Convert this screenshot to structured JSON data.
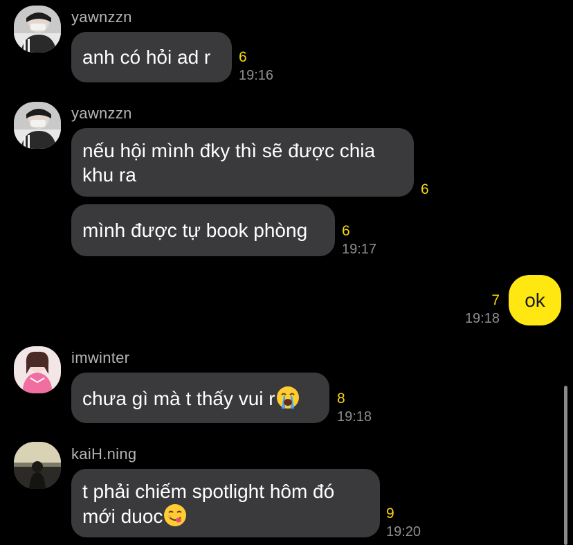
{
  "colors": {
    "background": "#000000",
    "incoming_bubble": "#3a3a3c",
    "outgoing_bubble": "#ffe812",
    "unread_count": "#f5d90a",
    "timestamp": "#8e8e93"
  },
  "messages": [
    {
      "sender": "yawnzzn",
      "avatar": "avatar-yawnzzn",
      "lines": [
        "anh có hỏi ad r"
      ],
      "unread": "6",
      "time": "19:16"
    },
    {
      "sender": "yawnzzn",
      "avatar": "avatar-yawnzzn",
      "lines": [
        "nếu hội mình đky thì sẽ được chia",
        "khu ra"
      ],
      "unread": "6",
      "time": ""
    },
    {
      "lines": [
        "mình được tự book phòng"
      ],
      "unread": "6",
      "time": "19:17"
    },
    {
      "outgoing": true,
      "lines": [
        "ok"
      ],
      "unread": "7",
      "time": "19:18"
    },
    {
      "sender": "imwinter",
      "avatar": "avatar-imwinter",
      "lines": [
        "chưa gì mà t thấy vui r"
      ],
      "emoji": "loudly-crying-face",
      "unread": "8",
      "time": "19:18"
    },
    {
      "sender": "kaiH.ning",
      "avatar": "avatar-kaih-ning",
      "lines": [
        "t phải chiếm spotlight hôm đó",
        "mới duoc"
      ],
      "emoji": "face-savoring-food",
      "unread": "9",
      "time": "19:20"
    }
  ]
}
